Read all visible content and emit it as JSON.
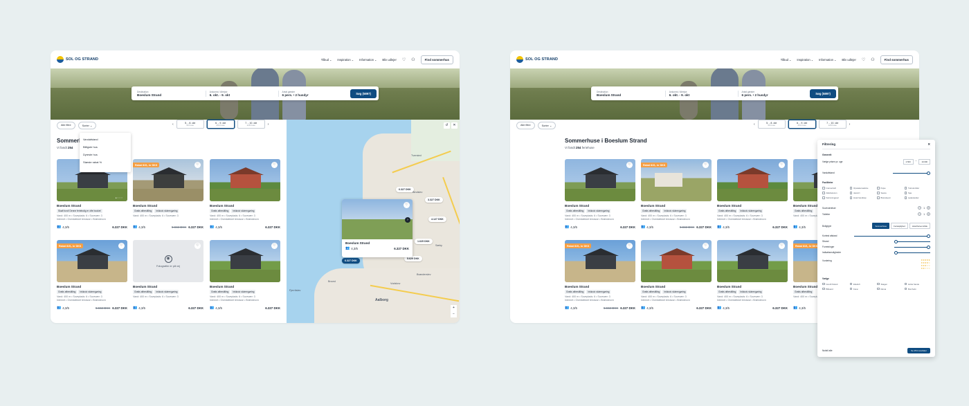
{
  "nav": {
    "logo": "SOL OG STRAND",
    "items": [
      "Tilbud",
      "Inspiration",
      "Information"
    ],
    "host": "Bliv udlejer",
    "find": "Find sommerhus"
  },
  "search": {
    "dest_label": "Destination",
    "dest_value": "Boeslum Strand",
    "dates_label": "Ankomst / Afrejse",
    "dates_value": "6. okt. - 9. okt",
    "guests_label": "Antal gæster",
    "guests_value": "6 pers. • 2 husdyr",
    "button": "Søg (5897)"
  },
  "filters": {
    "all": "Alle filtre",
    "sort": "Sorter"
  },
  "dates": [
    {
      "range": "5. - 8. okt",
      "count": "56 huse"
    },
    {
      "range": "6. - 9. okt",
      "count": "254 huse"
    },
    {
      "range": "7. - 10. okt",
      "count": "128 huse"
    }
  ],
  "sort_menu": [
    "Vandafstand",
    "Billigste hus",
    "Dyreste hus",
    "Største rabat %"
  ],
  "title1": "Sommerhuse i Boesl",
  "title2": "Sommerhuse i Boeslum Strand",
  "found_prefix": "Vi fandt",
  "found_count": "254",
  "found_suffix": "feriehuse",
  "cards": [
    {
      "name": "Boeslum Strand",
      "desc": "Vand: 400 m • Soveplads: 6 • Sovevær: 3",
      "desc2": "Internet • Overdækket terrasse • Brændeovn",
      "cap": "4,3/5",
      "price": "6.327 DKK",
      "old": "",
      "badge": "",
      "tags": [
        "Gratis afbestilling",
        "Inklusiv slutrengøring"
      ]
    },
    {
      "name": "Boeslum Strand",
      "desc": "Vand: 400 m • Soveplads: 6 • Sovevær: 3",
      "desc2": "",
      "cap": "4,3/5",
      "price": "6.327 DKK",
      "old": "5.842 DKK",
      "badge": "Rabat 815,- kr DKK",
      "tags": [
        "Gratis afbestilling",
        "Inklusiv slutrengøring"
      ]
    },
    {
      "name": "Boeslum Strand",
      "desc": "Vand: 400 m • Soveplads: 6 • Sovevær: 3",
      "desc2": "Internet • Overdækket terrasse • Brændeovn",
      "cap": "4,3/5",
      "price": "6.327 DKK",
      "old": "",
      "badge": "",
      "tags": [
        "Gratis afbestilling",
        "Inklusiv slutrengøring"
      ]
    },
    {
      "name": "Boeslum Strand",
      "desc": "Vand: 400 m • Soveplads: 6 • Sovevær: 3",
      "desc2": "Internet • Overdækket terrasse • Brændeovn",
      "cap": "4,3/5",
      "price": "6.327 DKK",
      "old": "5.842 DKK",
      "badge": "Rabat 815,- kr DKK",
      "tags": [
        "Gratis afbestilling",
        "Inklusiv slutrengøring"
      ]
    },
    {
      "name": "Boeslum Strand",
      "desc": "Vand: 400 m • Soveplads: 6 • Sovevær: 3",
      "desc2": "",
      "cap": "4,3/5",
      "price": "6.327 DKK",
      "old": "",
      "badge": "",
      "tags": [
        "Gratis afbestilling",
        "Inklusiv slutrengøring"
      ],
      "noimg": "Fotografier er på vej"
    },
    {
      "name": "Boeslum Strand",
      "desc": "Vand: 400 m • Soveplads: 6 • Sovevær: 3",
      "desc2": "Internet • Overdækket terrasse • Brændeovn",
      "cap": "4,3/5",
      "price": "6.327 DKK",
      "old": "",
      "badge": "",
      "tags": [
        "Gratis afbestilling",
        "Inklusiv slutrengøring"
      ]
    }
  ],
  "banner_note": "Skøll fund! Denne feriebolig er ofte booket",
  "map": {
    "pins": [
      "6.327 DKK",
      "3.327 DKK",
      "4.127 DKK",
      "1.625 DKK",
      "6.327 DKK",
      "5.629 DKK"
    ],
    "popup_name": "Boeslum Strand",
    "popup_cap": "4,3/5",
    "popup_price": "6.327 DKK",
    "labels": [
      "Bindslev",
      "Tversted",
      "Sæby",
      "Aalborg",
      "Brovst",
      "Vodskov",
      "Brønderslev",
      "Fjerritslev"
    ]
  },
  "panel": {
    "title": "Filtrering",
    "s1": "Generelt",
    "price_label": "Vælge prisen pr. uge",
    "min": "2.500",
    "max": "10.000",
    "distance": "Vandafstand",
    "s2": "Faciliteter",
    "facilities": [
      "Internet/wifi",
      "Opvaskemaskine",
      "Pejse",
      "Tørretumbler",
      "Aktivitetsrum",
      "Jacuzzi",
      "Sauna",
      "Spa",
      "Swimmingpool",
      "Husk handicap",
      "Brændeovn",
      "Ladestander"
    ],
    "bedrooms": "Soveværelser",
    "baths": "Toiletter",
    "type_label": "Boligtype",
    "types": [
      "Sommerhuse",
      "Ferielejlighed",
      "Hotel/ferieområde"
    ],
    "dist_items": [
      "Kortest afstand",
      "Strand",
      "Forretninger",
      "Indkøbsmuligheder"
    ],
    "rating": "Vurdering",
    "s3": "Vælge",
    "areas": [
      "Grenå Strand",
      "Ebeltoft",
      "Skagen",
      "Hvide Sande",
      "Blåvand",
      "Fanø",
      "Rømø",
      "Bornholm"
    ],
    "reset": "Nulstil alle",
    "go": "Se 254 resultater"
  }
}
